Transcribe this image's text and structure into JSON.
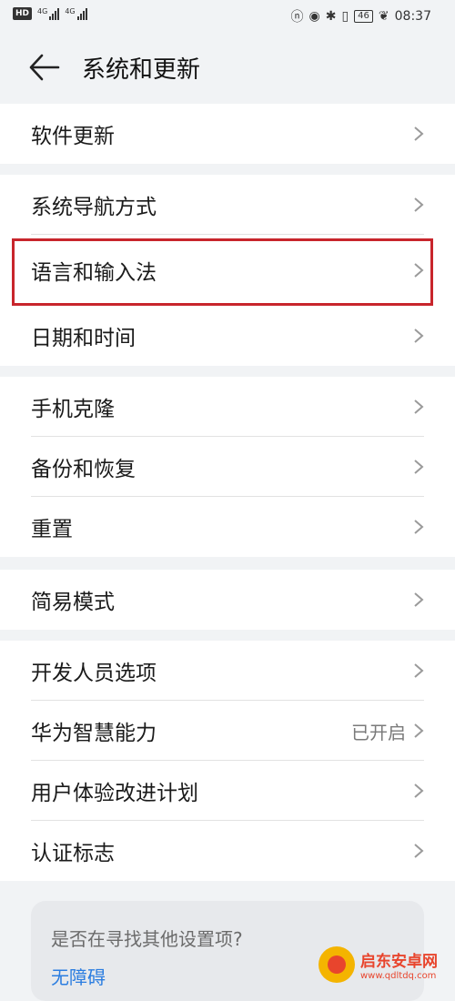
{
  "status_bar": {
    "left_badge": "HD",
    "signal_1": "4G",
    "signal_2": "4G",
    "battery": "46",
    "time": "08:37"
  },
  "header": {
    "title": "系统和更新",
    "back_icon": "arrow-left-icon"
  },
  "groups": [
    {
      "items": [
        {
          "label": "软件更新"
        }
      ]
    },
    {
      "items": [
        {
          "label": "系统导航方式"
        },
        {
          "label": "语言和输入法"
        },
        {
          "label": "日期和时间"
        }
      ]
    },
    {
      "items": [
        {
          "label": "手机克隆"
        },
        {
          "label": "备份和恢复"
        },
        {
          "label": "重置"
        }
      ]
    },
    {
      "items": [
        {
          "label": "简易模式"
        }
      ]
    },
    {
      "items": [
        {
          "label": "开发人员选项"
        },
        {
          "label": "华为智慧能力",
          "value": "已开启"
        },
        {
          "label": "用户体验改进计划"
        },
        {
          "label": "认证标志"
        }
      ]
    }
  ],
  "suggest": {
    "question": "是否在寻找其他设置项?",
    "link": "无障碍"
  },
  "watermark": {
    "cn": "启东安卓网",
    "url": "www.qdltdq.com"
  },
  "colors": {
    "highlight": "#c8252c",
    "link": "#2b7de0",
    "background": "#f1f3f5"
  }
}
